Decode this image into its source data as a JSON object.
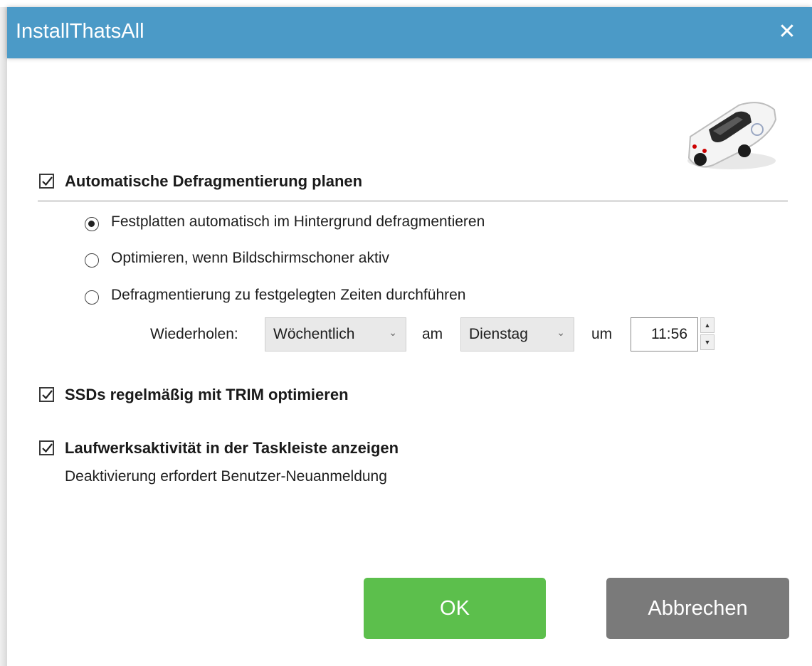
{
  "window": {
    "title": "InstallThatsAll",
    "close_icon": "close-icon"
  },
  "auto_defrag": {
    "checked": true,
    "label": "Automatische Defragmentierung planen",
    "options": [
      {
        "label": "Festplatten automatisch im Hintergrund defragmentieren",
        "selected": true
      },
      {
        "label": "Optimieren, wenn Bildschirmschoner aktiv",
        "selected": false
      },
      {
        "label": "Defragmentierung zu festgelegten Zeiten durchführen",
        "selected": false
      }
    ],
    "schedule": {
      "repeat_label": "Wiederholen:",
      "repeat_value": "Wöchentlich",
      "day_label": "am",
      "day_value": "Dienstag",
      "time_label": "um",
      "time_value": "11:56"
    }
  },
  "trim": {
    "checked": true,
    "label": "SSDs regelmäßig mit TRIM optimieren"
  },
  "taskbar": {
    "checked": true,
    "label": "Laufwerksaktivität in der Taskleiste anzeigen",
    "hint": "Deaktivierung erfordert Benutzer-Neuanmeldung"
  },
  "buttons": {
    "ok": "OK",
    "cancel": "Abbrechen"
  },
  "colors": {
    "titlebar": "#4b9ac7",
    "ok": "#5cbf4c",
    "cancel": "#7a7a7a"
  }
}
